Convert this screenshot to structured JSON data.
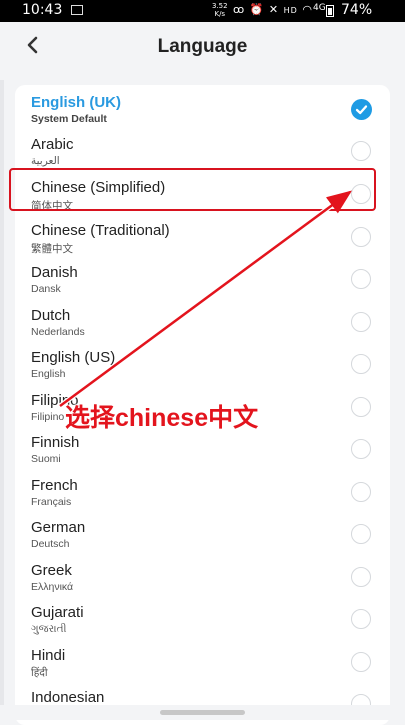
{
  "status_bar": {
    "time": "10:43",
    "speed_value": "3.52",
    "speed_unit": "K/s",
    "network": "4G",
    "battery_percent": "74%",
    "battery_level": 0.74,
    "icons": [
      "image-icon",
      "voicemail-icon",
      "alarm-icon",
      "mute-icon",
      "hd-icon",
      "wifi-icon",
      "signal-icon",
      "battery-icon"
    ]
  },
  "header": {
    "title": "Language",
    "back_icon": "chevron-left-icon"
  },
  "languages": [
    {
      "name": "English (UK)",
      "native": "System Default",
      "selected": true
    },
    {
      "name": "Arabic",
      "native": "العربية",
      "selected": false
    },
    {
      "name": "Chinese (Simplified)",
      "native": "简体中文",
      "selected": false
    },
    {
      "name": "Chinese (Traditional)",
      "native": "繁體中文",
      "selected": false
    },
    {
      "name": "Danish",
      "native": "Dansk",
      "selected": false
    },
    {
      "name": "Dutch",
      "native": "Nederlands",
      "selected": false
    },
    {
      "name": "English (US)",
      "native": "English",
      "selected": false
    },
    {
      "name": "Filipino",
      "native": "Filipino",
      "selected": false
    },
    {
      "name": "Finnish",
      "native": "Suomi",
      "selected": false
    },
    {
      "name": "French",
      "native": "Français",
      "selected": false
    },
    {
      "name": "German",
      "native": "Deutsch",
      "selected": false
    },
    {
      "name": "Greek",
      "native": "Ελληνικά",
      "selected": false
    },
    {
      "name": "Gujarati",
      "native": "ગુજરાતી",
      "selected": false
    },
    {
      "name": "Hindi",
      "native": "हिंदी",
      "selected": false
    },
    {
      "name": "Indonesian",
      "native": "",
      "selected": false
    }
  ],
  "annotation": {
    "text": "选择chinese中文",
    "color": "#e3141d"
  },
  "colors": {
    "accent": "#2a9ae0",
    "check": "#1e9be4",
    "highlight": "#d8131f"
  }
}
